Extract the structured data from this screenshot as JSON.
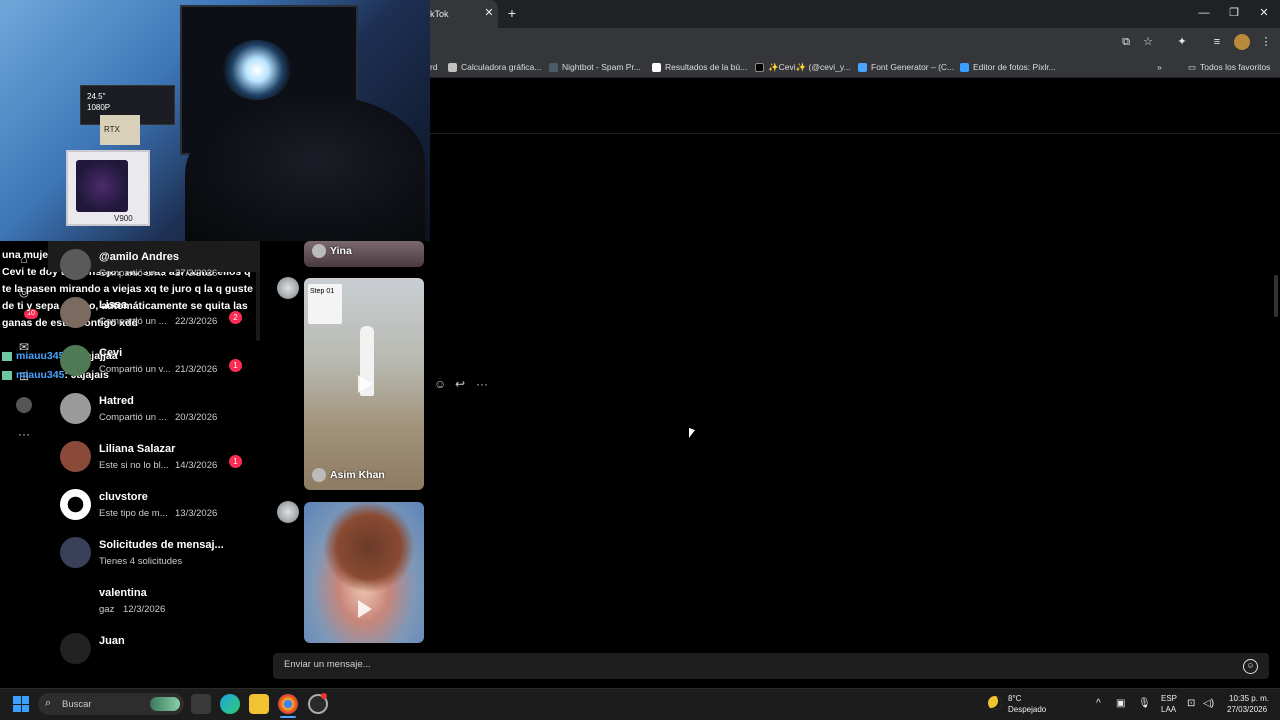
{
  "browser": {
    "tab_title": "kTok",
    "tab_close": "✕",
    "new_tab": "+",
    "bookmarks": [
      {
        "label": "rd",
        "color": "#888888"
      },
      {
        "label": "Calculadora gráfica...",
        "color": "#c0c0c0"
      },
      {
        "label": "Nightbot - Spam Pr...",
        "color": "#4a5c6a"
      },
      {
        "label": "Resultados de la bú...",
        "color": "#ffffff"
      },
      {
        "label": "✨Cevi✨ (@cevi_y...",
        "color": "#000000"
      },
      {
        "label": "Font Generator – (C...",
        "color": "#4aa3ff"
      },
      {
        "label": "Editor de fotos: Pixlr...",
        "color": "#3aa0ff"
      }
    ],
    "bookmarks_more": "»",
    "all_bookmarks": "Todos los favoritos",
    "window_controls": {
      "minimize": "—",
      "restore": "❐",
      "close": "✕"
    }
  },
  "webcam": {
    "monitor_label_1": "24.5\"",
    "monitor_label_2": "1080P",
    "box_label": "V900",
    "rtx_label": "RTX"
  },
  "chat_overlay": {
    "message": "una mujer así caminar en la calle xq se saca la vrg. Cevi te doy un consejo? No seas así como ellos q te la pasen mirando a viejas xq te juro q la q guste de ti y sepa de eso, automáticamente se quita las ganas de estar contigo xdd",
    "lines": [
      {
        "user": "miauu345",
        "text": ": Jajajajjaa"
      },
      {
        "user": "miauu345",
        "text": ": Jajajais"
      }
    ]
  },
  "nav": {
    "more": "···",
    "badge": "10"
  },
  "conversations": [
    {
      "name": "@amilo Andres",
      "preview": "Compartió un ...",
      "date": "27/3/2026",
      "badge": "",
      "avatar_color": "#5a5a5a"
    },
    {
      "name": "Lissa",
      "preview": "Compartió un ...",
      "date": "22/3/2026",
      "badge": "2",
      "avatar_color": "#7a6a60"
    },
    {
      "name": "Cevi",
      "preview": "Compartió un v...",
      "date": "21/3/2026",
      "badge": "1",
      "avatar_color": "#4f7a55"
    },
    {
      "name": "Hatred",
      "preview": "Compartió un ...",
      "date": "20/3/2026",
      "badge": "",
      "avatar_color": "#9a9a9a"
    },
    {
      "name": "Liliana Salazar",
      "preview": "Este si no lo bl...",
      "date": "14/3/2026",
      "badge": "1",
      "avatar_color": "#8a4a3a"
    },
    {
      "name": "cluvstore",
      "preview": "Este tipo de m...",
      "date": "13/3/2026",
      "badge": "",
      "avatar_color": "#ffffff"
    },
    {
      "name": "Solicitudes de mensaj...",
      "preview": "Tienes 4 solicitudes",
      "date": "",
      "badge": "",
      "avatar_color": "#3a3f5a"
    },
    {
      "name": "valentina",
      "preview": "gaz",
      "date": "12/3/2026",
      "badge": "",
      "avatar_color": "#000000"
    },
    {
      "name": "Juan",
      "preview": "",
      "date": "",
      "badge": "",
      "avatar_color": "#222222"
    }
  ],
  "messages": [
    {
      "author": "Yina"
    },
    {
      "author": "Asim Khan",
      "step_label": "Step 01"
    },
    {
      "author": ""
    }
  ],
  "input": {
    "placeholder": "Enviar un mensaje..."
  },
  "taskbar": {
    "search": "Buscar",
    "weather_temp": "8°C",
    "weather_desc": "Despejado",
    "lang_1": "ESP",
    "lang_2": "LAA",
    "time": "10:35 p. m.",
    "date": "27/03/2026"
  }
}
